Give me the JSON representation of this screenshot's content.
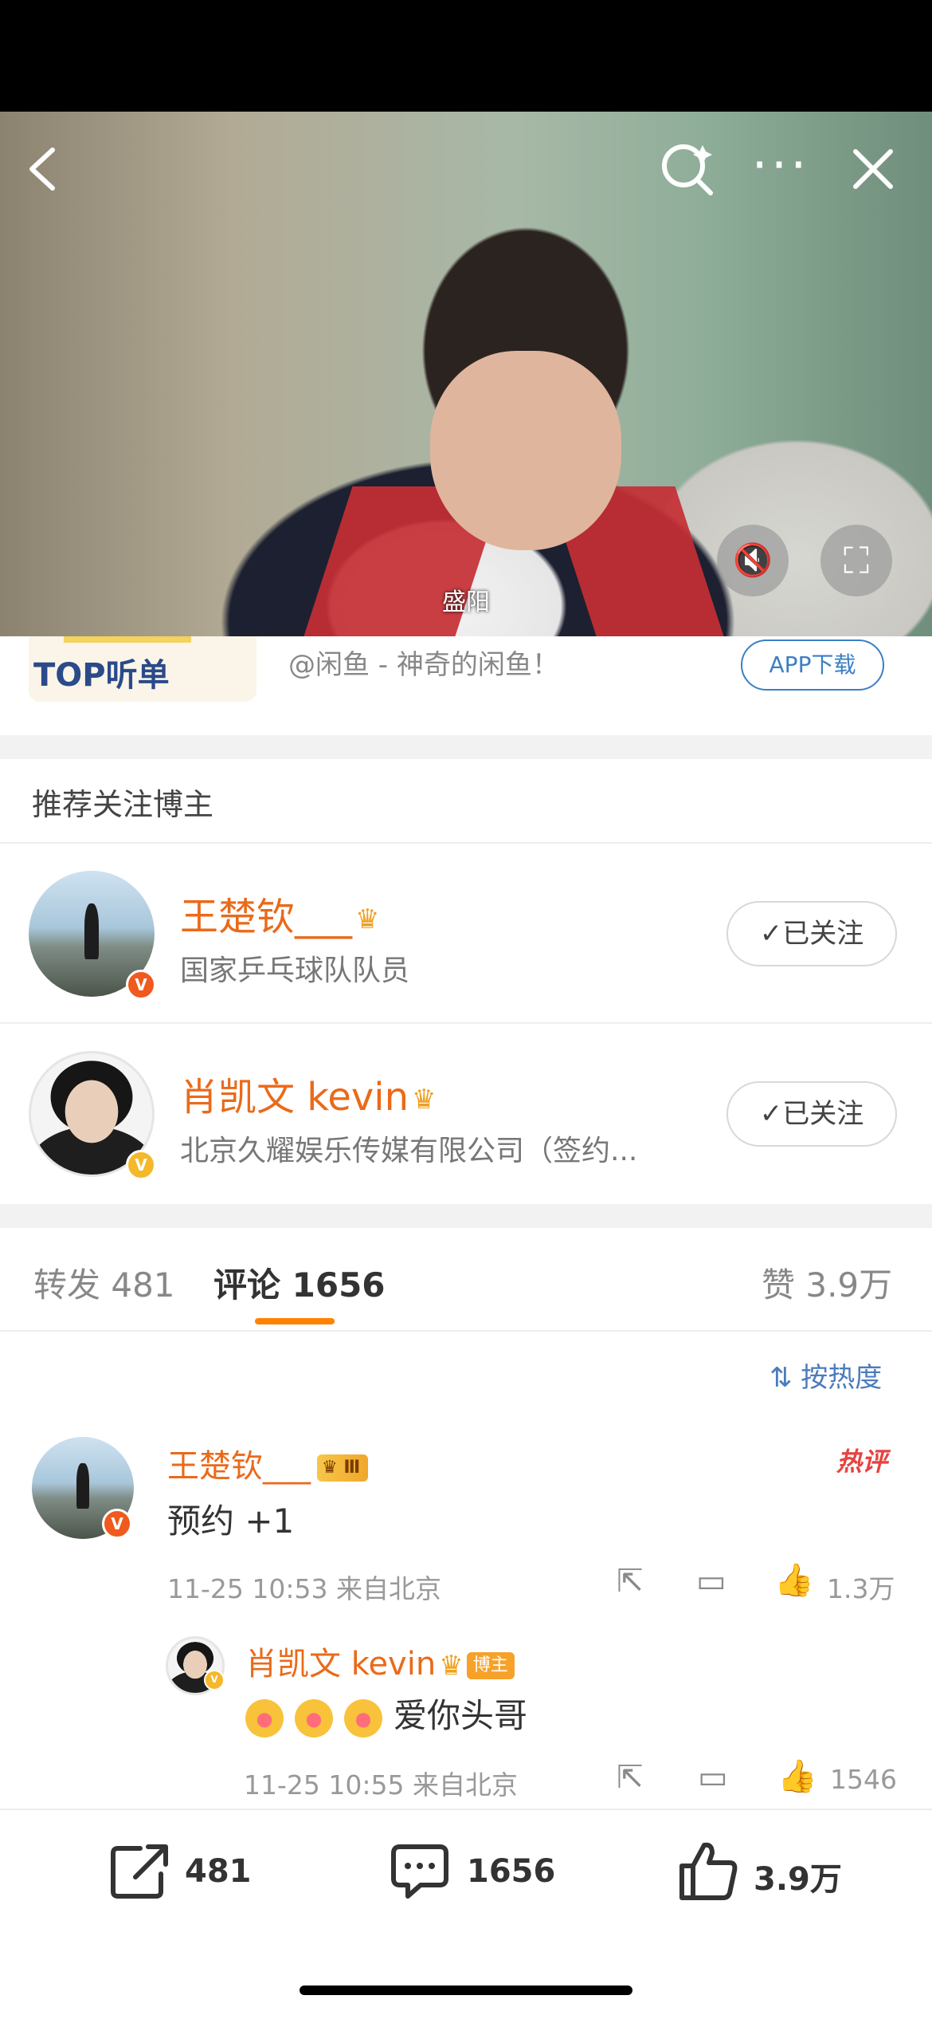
{
  "video": {
    "subtitle": "盛阳",
    "icons": [
      "back-icon",
      "search-icon",
      "more-icon",
      "close-icon",
      "mute-icon",
      "fullscreen-icon"
    ]
  },
  "ad": {
    "card_label": "TOP听单",
    "text": "@闲鱼 - 神奇的闲鱼！",
    "button": "APP下载"
  },
  "recommend": {
    "title": "推荐关注博主",
    "bloggers": [
      {
        "name": "王楚钦___",
        "desc": "国家乒乓球队队员",
        "badge": "V",
        "follow": "已关注"
      },
      {
        "name": "肖凯文 kevin",
        "desc": "北京久耀娱乐传媒有限公司（签约...",
        "badge": "V",
        "follow": "已关注"
      }
    ]
  },
  "tabs": {
    "repost": "转发 481",
    "comment": "评论 1656",
    "like": "赞 3.9万"
  },
  "sort_label": "按热度",
  "comments": [
    {
      "name": "王楚钦___",
      "level": "Ⅲ",
      "hot_label": "热评",
      "text": "预约 +1",
      "time": "11-25 10:53",
      "location": "来自北京",
      "likes": "1.3万"
    }
  ],
  "reply": {
    "name": "肖凯文 kevin",
    "role_badge": "博主",
    "text": "爱你头哥",
    "time": "11-25 10:55",
    "location": "来自北京",
    "likes": "1546"
  },
  "bottom_bar": {
    "repost": "481",
    "comment": "1656",
    "like": "3.9万"
  },
  "colors": {
    "accent_orange": "#ff8200",
    "username_orange": "#ea6a19",
    "link_blue": "#3b7fc4"
  }
}
